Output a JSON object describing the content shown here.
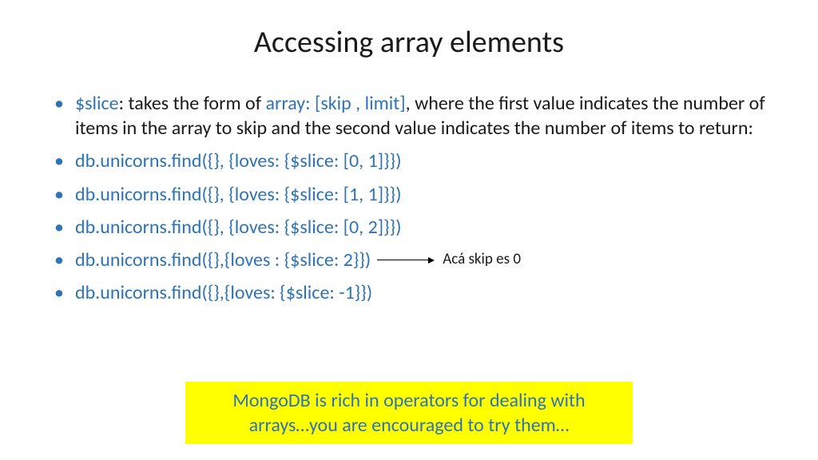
{
  "title": "Accessing array elements",
  "bullets": {
    "b0": {
      "part1": "$slice",
      "part2": ": takes the form of ",
      "part3": "array: [skip , limit]",
      "part4": ", where the first value indicates the number of items in the array to skip and the second value indicates the number of items to return:"
    },
    "b1": "db.unicorns.find({}, {loves: {$slice: [0, 1]}})",
    "b2": "db.unicorns.find({}, {loves: {$slice: [1, 1]}})",
    "b3": "db.unicorns.find({}, {loves: {$slice: [0, 2]}})",
    "b4": "db.unicorns.find({},{loves : {$slice: 2}})",
    "b5": "db.unicorns.find({},{loves: {$slice: -1}})"
  },
  "annotation": "Acá skip es 0",
  "callout": "MongoDB is rich in operators for dealing with arrays…you are encouraged to try them…"
}
